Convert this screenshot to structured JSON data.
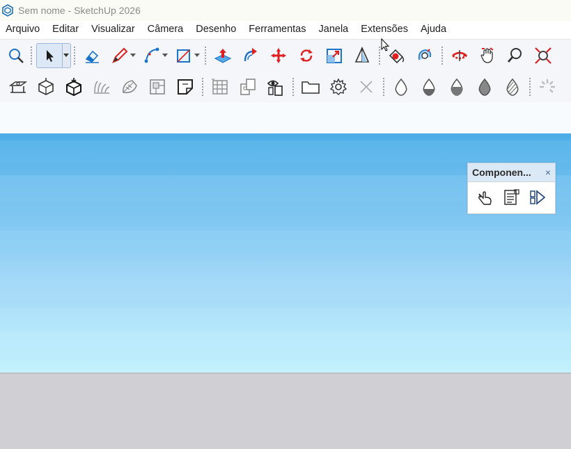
{
  "window": {
    "title": "Sem nome - SketchUp 2026",
    "app_icon": "sketchup-logo-icon"
  },
  "menubar": {
    "items": [
      "Arquivo",
      "Editar",
      "Visualizar",
      "Câmera",
      "Desenho",
      "Ferramentas",
      "Janela",
      "Extensões",
      "Ajuda"
    ]
  },
  "toolbar1": {
    "tools": [
      "search-icon",
      "select-arrow-icon",
      "eraser-icon",
      "pencil-line-icon",
      "arc-icon",
      "rectangle-icon",
      "push-pull-icon",
      "follow-me-icon",
      "move-icon",
      "rotate-icon",
      "scale-icon",
      "tape-measure-icon",
      "paint-bucket-icon",
      "orbit-icon",
      "pan-icon",
      "zoom-icon",
      "zoom-extents-icon"
    ]
  },
  "toolbar2": {
    "tools": [
      "section-plane-icon",
      "box-top-icon",
      "box-download-icon",
      "sandbox-icon",
      "leaf-icon",
      "components-icon",
      "face-style-icon",
      "grid-icon",
      "copy-icon",
      "view-icon",
      "folder-icon",
      "settings-gear-icon",
      "close-x-icon",
      "drop-outline-icon",
      "drop-half-icon",
      "drop-filled-icon",
      "drop-solid-icon",
      "drop-hatched-icon",
      "loading-spinner-icon"
    ]
  },
  "components_tray": {
    "title": "Componen...",
    "close_label": "×",
    "buttons": [
      "hand-icon",
      "details-list-icon",
      "play-component-icon"
    ]
  },
  "colors": {
    "sky_top": "#4aace6",
    "sky_bottom": "#c4f1fd",
    "ground": "#cfcfd4",
    "accent_red": "#e02020",
    "accent_blue": "#1a73c8",
    "tray_header": "#dbe8f6"
  }
}
